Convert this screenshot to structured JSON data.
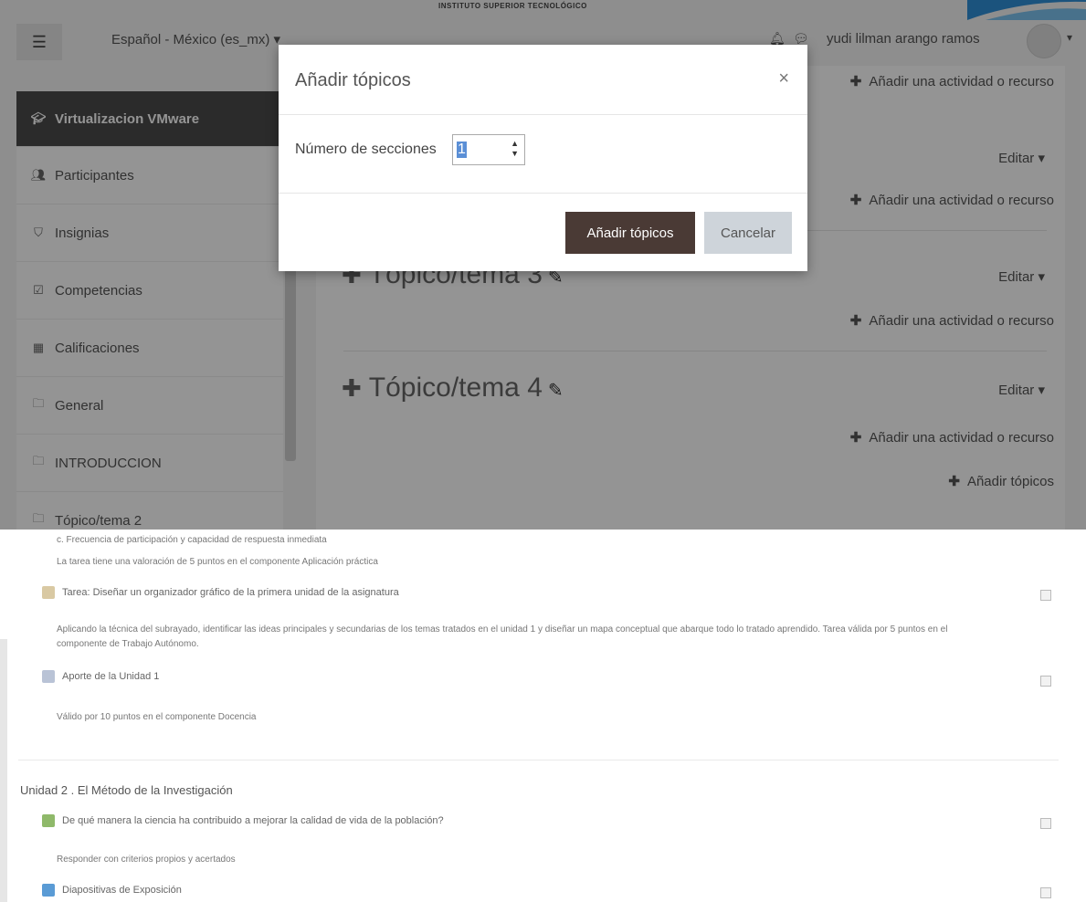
{
  "banner": {
    "institution": "INSTITUTO SUPERIOR TECNOLÓGICO"
  },
  "navbar": {
    "language": "Español - México (es_mx) ▾",
    "user_name": "yudi lilman arango ramos"
  },
  "sidebar": {
    "items": [
      {
        "label": "Virtualizacion VMware",
        "icon": "graduation-cap-icon",
        "active": true
      },
      {
        "label": "Participantes",
        "icon": "users-icon"
      },
      {
        "label": "Insignias",
        "icon": "shield-icon"
      },
      {
        "label": "Competencias",
        "icon": "checkbox-icon"
      },
      {
        "label": "Calificaciones",
        "icon": "table-icon"
      },
      {
        "label": "General",
        "icon": "folder-icon"
      },
      {
        "label": "INTRODUCCION",
        "icon": "folder-icon"
      },
      {
        "label": "Tópico/tema 2",
        "icon": "folder-icon"
      }
    ]
  },
  "main": {
    "add_activity": "Añadir una actividad o recurso",
    "edit": "Editar",
    "topic3": "Tópico/tema 3",
    "topic4": "Tópico/tema 4",
    "add_topics": "Añadir tópicos"
  },
  "modal": {
    "title": "Añadir tópicos",
    "field_label": "Número de secciones",
    "field_value": "1",
    "submit": "Añadir tópicos",
    "cancel": "Cancelar"
  },
  "course": {
    "line1": "c. Frecuencia de participación y capacidad de respuesta inmediata",
    "line2": "La tarea tiene una valoración de 5 puntos en el componente Aplicación práctica",
    "task_title": "Tarea: Diseñar un organizador gráfico de la primera unidad de la asignatura",
    "task_desc1": "Aplicando la técnica del subrayado, identificar las ideas principales y secundarias de los temas tratados en el unidad 1 y diseñar un mapa conceptual que abarque todo lo tratado aprendido. Tarea válida por 5 puntos en el",
    "task_desc2": "componente de Trabajo Autónomo.",
    "aporte_title": "Aporte de la Unidad 1",
    "aporte_desc": "Válido por 10 puntos en el componente Docencia",
    "unit2": "Unidad 2 . El Método de la Investigación",
    "forum_title": "De qué manera la ciencia ha contribuido a mejorar la calidad de vida de la población?",
    "forum_desc": "Responder con criterios propios y acertados",
    "slides_title": "Diapositivas de Exposición"
  },
  "colors": {
    "primary_button": "#4a3a35",
    "secondary_button": "#ced4da",
    "sidebar_active": "#4a4a4a"
  }
}
